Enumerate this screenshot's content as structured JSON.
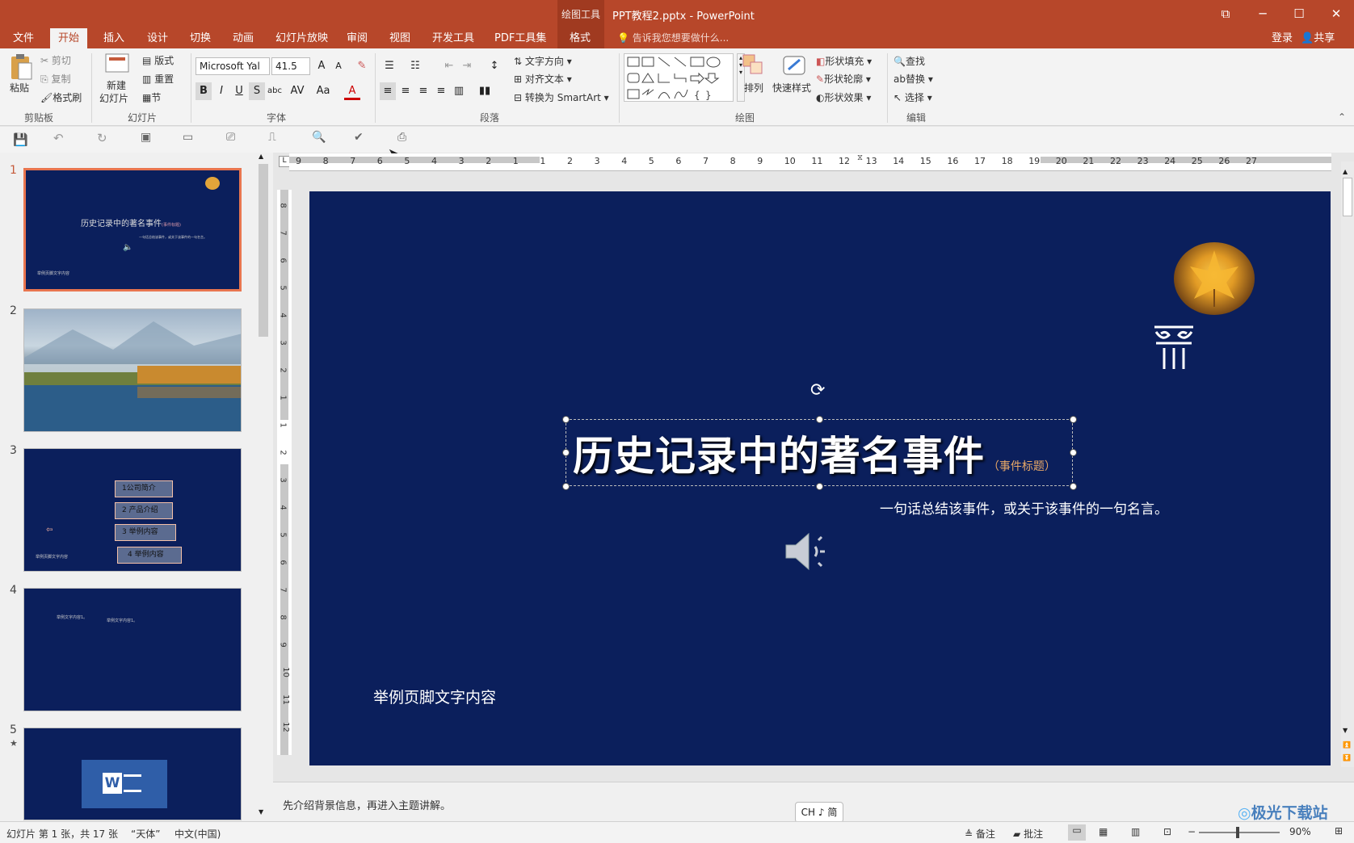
{
  "titlebar": {
    "context_group": "绘图工具",
    "doc_title": "PPT教程2.pptx - PowerPoint",
    "tabs": [
      "文件",
      "开始",
      "插入",
      "设计",
      "切换",
      "动画",
      "幻灯片放映",
      "审阅",
      "视图",
      "开发工具",
      "PDF工具集",
      "格式"
    ],
    "active_tab": "开始",
    "tellme": "告诉我您想要做什么...",
    "login": "登录",
    "share": "共享"
  },
  "ribbon": {
    "clipboard": {
      "paste": "粘贴",
      "cut": "剪切",
      "copy": "复制",
      "format_painter": "格式刷",
      "label": "剪贴板"
    },
    "slides": {
      "new_slide_line1": "新建",
      "new_slide_line2": "幻灯片",
      "layout": "版式",
      "reset": "重置",
      "section": "节",
      "label": "幻灯片"
    },
    "font": {
      "name": "Microsoft Yal",
      "size": "41.5",
      "label": "字体"
    },
    "paragraph": {
      "text_direction": "文字方向",
      "align_text": "对齐文本",
      "smartart": "转换为 SmartArt",
      "label": "段落"
    },
    "drawing": {
      "arrange": "排列",
      "quick_styles": "快速样式",
      "shape_fill": "形状填充",
      "shape_outline": "形状轮廓",
      "shape_effects": "形状效果",
      "label": "绘图"
    },
    "editing": {
      "find": "查找",
      "replace": "替换",
      "select": "选择",
      "label": "编辑"
    }
  },
  "thumbnails": {
    "numbers": [
      "1",
      "2",
      "3",
      "4",
      "5"
    ],
    "t1_title": "历史记录中的著名事件",
    "t1_title_small": "(事件标题)",
    "t1_sub": "一句话总结该事件，或关于该事件的一句名言。",
    "t1_footer": "举例页脚文字内容",
    "t3_items": [
      "1公司简介",
      "2 产品介绍",
      "3 举例内容",
      "4 举例内容"
    ],
    "t3_footer": "举例页脚文字内容",
    "t4_a": "举例文字内容1。",
    "t4_b": "举例文字内容1。"
  },
  "ruler": {
    "h_labels": [
      "9",
      "8",
      "7",
      "6",
      "5",
      "4",
      "3",
      "2",
      "1",
      "1",
      "2",
      "3",
      "4",
      "5",
      "6",
      "7",
      "8",
      "9",
      "10",
      "11",
      "12",
      "13",
      "14",
      "15",
      "16",
      "17",
      "18",
      "19",
      "20",
      "21",
      "22",
      "23",
      "24",
      "25",
      "26",
      "27"
    ],
    "v_labels": [
      "8",
      "7",
      "6",
      "5",
      "4",
      "3",
      "2",
      "1",
      "1",
      "2",
      "3",
      "4",
      "5",
      "6",
      "7",
      "8",
      "9",
      "10",
      "11",
      "12"
    ]
  },
  "slide": {
    "title": "历史记录中的著名事件",
    "title_tag": "（事件标题）",
    "subtitle": "一句话总结该事件，或关于该事件的一句名言。",
    "footer": "举例页脚文字内容"
  },
  "notes": {
    "text": "先介绍背景信息，再进入主题讲解。"
  },
  "ime": {
    "label": "CH ♪ 简"
  },
  "status": {
    "slide_info": "幻灯片 第 1 张，共 17 张",
    "theme": "“天体”",
    "language": "中文(中国)",
    "notes_btn": "备注",
    "comments_btn": "批注",
    "zoom": "90%",
    "watermark": "极光下载站"
  }
}
